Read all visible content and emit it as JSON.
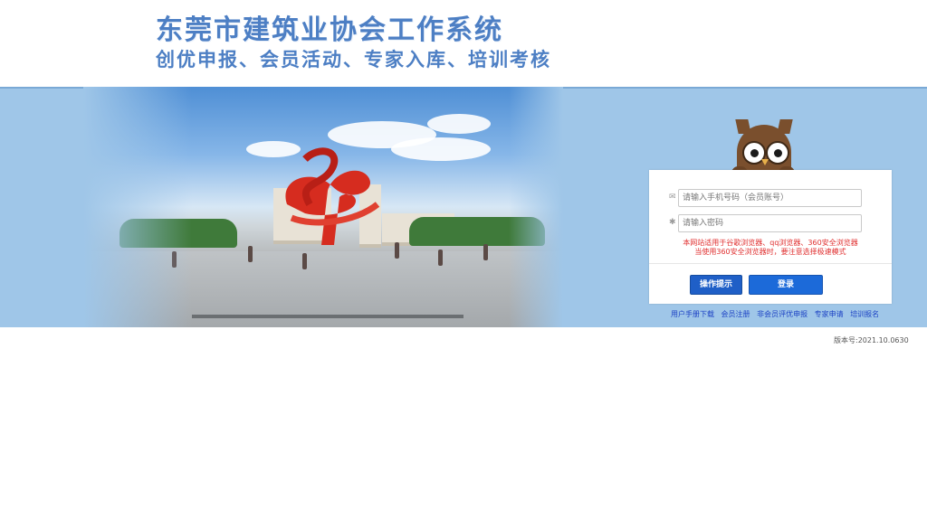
{
  "header": {
    "title": "东莞市建筑业协会工作系统",
    "subtitle": "创优申报、会员活动、专家入库、培训考核"
  },
  "login": {
    "phone_placeholder": "请输入手机号码（会员账号）",
    "password_placeholder": "请输入密码",
    "notice_line1": "本网站适用于谷歌浏览器、qq浏览器、360安全浏览器",
    "notice_line2": "当使用360安全浏览器时，要注意选择极速模式",
    "tips_button": "操作提示",
    "login_button": "登录"
  },
  "links": [
    "用户手册下载",
    "会员注册",
    "非会员评优申报",
    "专家申请",
    "培训报名"
  ],
  "footer": {
    "version": "版本号:2021.10.0630"
  },
  "colors": {
    "title": "#4d7fc4",
    "banner_bg": "#9fc6e8",
    "button": "#1c6ad9",
    "notice": "#e03030",
    "link": "#1d43c4"
  },
  "icons": {
    "phone_field": "envelope-icon",
    "password_field": "asterisk-icon",
    "mascot": "owl-icon"
  }
}
